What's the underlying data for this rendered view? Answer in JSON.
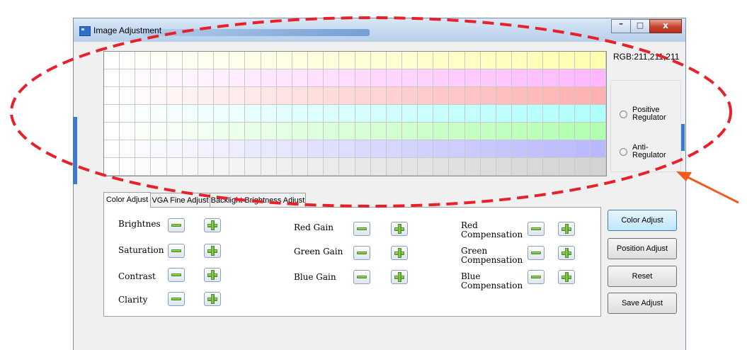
{
  "window": {
    "title": "Image Adjustment",
    "caption_buttons": {
      "minimize": "–",
      "maximize": "□",
      "close": "x"
    }
  },
  "palette": {
    "rows": [
      {
        "name": "yellow",
        "start": "#ffffff",
        "end": "#ffffb0"
      },
      {
        "name": "magenta",
        "start": "#ffffff",
        "end": "#ffb8ff"
      },
      {
        "name": "red",
        "start": "#ffffff",
        "end": "#ffb0b0"
      },
      {
        "name": "cyan",
        "start": "#ffffff",
        "end": "#b0ffff"
      },
      {
        "name": "green",
        "start": "#ffffff",
        "end": "#b0ffb0"
      },
      {
        "name": "blue",
        "start": "#ffffff",
        "end": "#b8b8ff"
      },
      {
        "name": "gray",
        "start": "#ffffff",
        "end": "#d3d3d3"
      }
    ],
    "columns": 32
  },
  "rgb_readout": "RGB:211,211,211",
  "regulators": [
    {
      "label": "Positive Regulator",
      "checked": false
    },
    {
      "label": "Anti-Regulator",
      "checked": false
    }
  ],
  "tabs": [
    {
      "label": "Color Adjust",
      "active": true
    },
    {
      "label": "VGA Fine Adjust",
      "active": false
    },
    {
      "label": "Backlight Brightness Adjust",
      "active": false
    }
  ],
  "controls": {
    "brightness": "Brightnes",
    "saturation": "Saturation",
    "contrast": "Contrast",
    "clarity": "Clarity",
    "red_gain": "Red Gain",
    "green_gain": "Green Gain",
    "blue_gain": "Blue Gain",
    "red_comp": "Red Compensation",
    "green_comp": "Green Compensation",
    "blue_comp": "Blue Compensation"
  },
  "side_buttons": {
    "color_adjust": "Color Adjust",
    "position_adjust": "Position Adjust",
    "reset": "Reset",
    "save_adjust": "Save Adjust"
  },
  "colors": {
    "annotation_ellipse": "#e8202a",
    "annotation_arrow": "#f05a1e",
    "window_accent": "#3a7bd5"
  }
}
